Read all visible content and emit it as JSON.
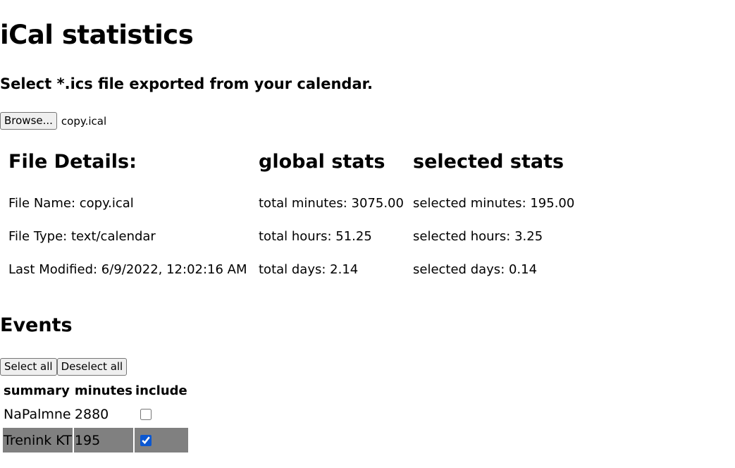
{
  "page": {
    "title": "iCal statistics",
    "subtitle": "Select *.ics file exported from your calendar."
  },
  "file_input": {
    "button_label": "Browse...",
    "selected_file": "copy.ical"
  },
  "file_details": {
    "heading": "File Details:",
    "name": "File Name: copy.ical",
    "type": "File Type: text/calendar",
    "modified": "Last Modified: 6/9/2022, 12:02:16 AM"
  },
  "global_stats": {
    "heading": "global stats",
    "minutes": "total minutes: 3075.00",
    "hours": "total hours: 51.25",
    "days": "total days: 2.14"
  },
  "selected_stats": {
    "heading": "selected stats",
    "minutes": "selected minutes: 195.00",
    "hours": "selected hours: 3.25",
    "days": "selected days: 0.14"
  },
  "events": {
    "heading": "Events",
    "select_all_label": "Select all",
    "deselect_all_label": "Deselect all",
    "columns": [
      "summary",
      "minutes",
      "include"
    ],
    "rows": [
      {
        "summary": "NaPalmne",
        "minutes": "2880",
        "include": false
      },
      {
        "summary": "Trenink KT",
        "minutes": "195",
        "include": true
      }
    ]
  },
  "colors": {
    "selected_row_bg": "#808080",
    "checkbox_accent": "#0b57d0"
  }
}
